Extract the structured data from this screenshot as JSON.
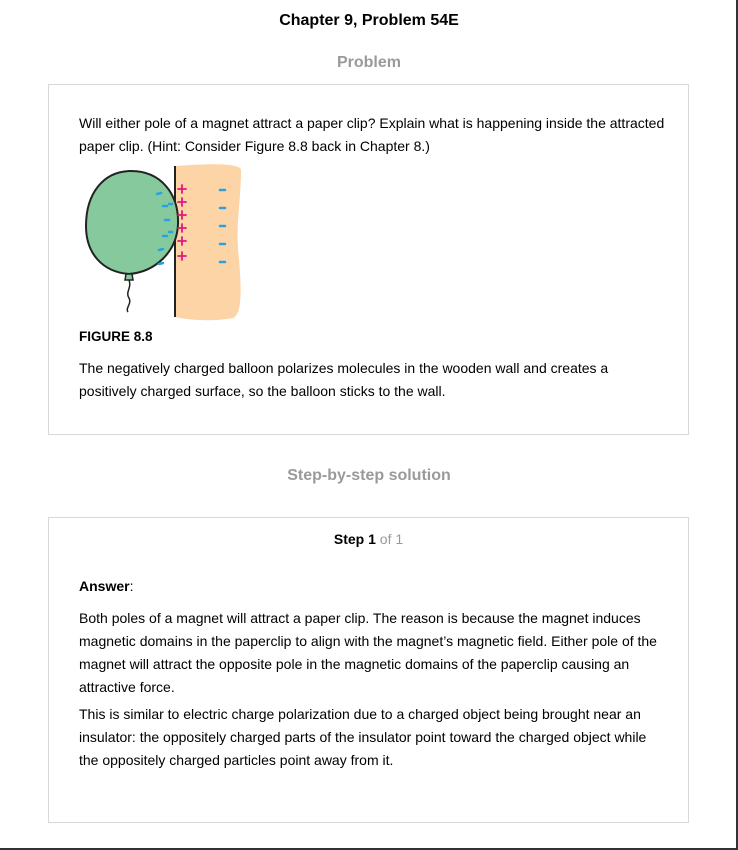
{
  "header": {
    "title": "Chapter 9, Problem 54E"
  },
  "problem": {
    "heading": "Problem",
    "question": "Will either pole of a magnet attract a paper clip? Explain what is happening inside the attracted paper clip. (Hint: Consider Figure 8.8 back in Chapter 8.)",
    "figure": {
      "label": "FIGURE 8.8",
      "caption": "The negatively charged balloon polarizes molecules in the wooden wall and creates a positively charged surface, so the balloon sticks to the wall.",
      "colors": {
        "balloon": "#85c99c",
        "wall": "#fdd4a5",
        "positive": "#e0187e",
        "negative": "#29a3e0"
      }
    }
  },
  "solution": {
    "heading": "Step-by-step solution",
    "step": {
      "label": "Step",
      "number": "1",
      "of_text": "of 1"
    },
    "answer_label": "Answer",
    "answer_colon": ":",
    "paragraphs": [
      "Both poles of a magnet will attract a paper clip. The reason is because the magnet induces magnetic domains in the paperclip to align with the magnet’s magnetic field. Either pole of the magnet will attract the opposite pole in the magnetic domains of the paperclip causing an attractive force.",
      "This is similar to electric charge polarization due to a charged object being brought near an insulator: the oppositely charged parts of the insulator point toward the charged object while the oppositely charged particles point away from it."
    ]
  }
}
